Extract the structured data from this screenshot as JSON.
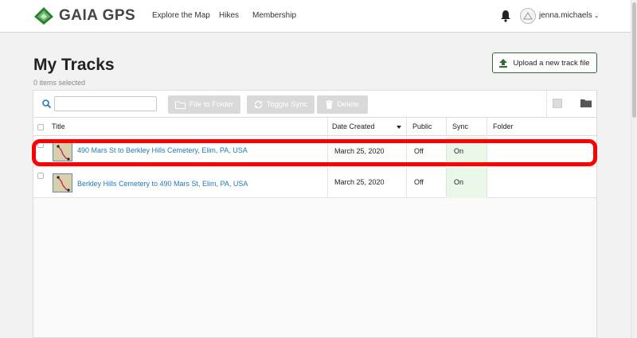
{
  "header": {
    "brand": "GAIA GPS",
    "nav": [
      "Explore the Map",
      "Hikes",
      "Membership"
    ],
    "username": "jenna.michaels",
    "user_chevron": "⌄"
  },
  "page": {
    "title": "My Tracks",
    "selected_count": "0 items selected",
    "upload_label": "Upload a new track file"
  },
  "toolbar": {
    "search_value": "",
    "file_to_folder": "File to Folder",
    "toggle_sync": "Toggle Sync",
    "delete": "Delete"
  },
  "table": {
    "columns": [
      "Title",
      "Date Created",
      "Public",
      "Sync",
      "Folder"
    ],
    "rows": [
      {
        "title": "490 Mars St to Berkley Hills Cemetery, Elim, PA, USA",
        "date": "March 25, 2020",
        "public": "Off",
        "sync": "On",
        "folder": ""
      },
      {
        "title": "Berkley Hills Cemetery to 490 Mars St, Elim, PA, USA",
        "date": "March 25, 2020",
        "public": "Off",
        "sync": "On",
        "folder": ""
      }
    ]
  },
  "colors": {
    "brand_green": "#2e6b3a",
    "link_blue": "#1f7ab8",
    "sync_on_bg": "#eaf8ea",
    "highlight_red": "#ff0000"
  }
}
